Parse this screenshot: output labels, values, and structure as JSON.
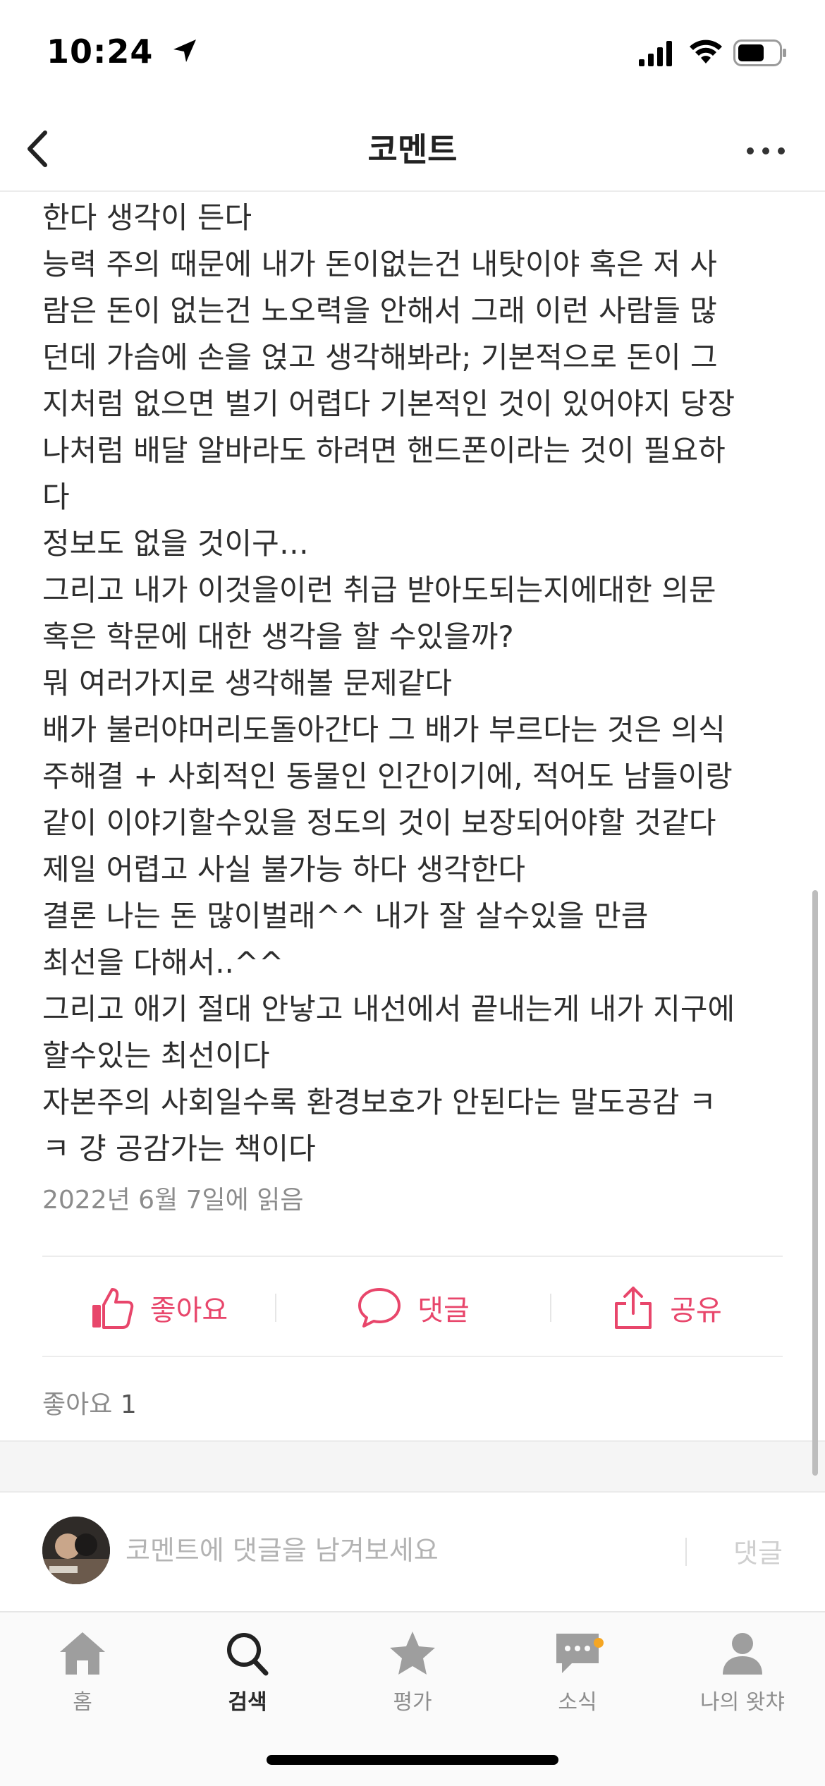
{
  "status_bar": {
    "time": "10:24"
  },
  "nav": {
    "title": "코멘트"
  },
  "comment": {
    "lines": [
      "한다 생각이 든다",
      "능력 주의 때문에 내가 돈이없는건 내탓이야 혹은 저 사",
      "람은 돈이 없는건 노오력을 안해서 그래 이런 사람들 많",
      "던데 가슴에 손을 얹고 생각해봐라; 기본적으로 돈이 그",
      "지처럼 없으면 벌기 어렵다 기본적인 것이 있어야지 당장",
      "나처럼 배달 알바라도 하려면 핸드폰이라는 것이 필요하",
      "다",
      "정보도 없을 것이구…",
      "그리고 내가 이것을이런 취급 받아도되는지에대한 의문",
      "혹은 학문에 대한 생각을 할 수있을까?",
      "뭐 여러가지로 생각해볼 문제같다",
      "배가 불러야머리도돌아간다 그 배가 부르다는 것은 의식",
      "주해결 + 사회적인 동물인 인간이기에, 적어도 남들이랑",
      "같이 이야기할수있을 정도의 것이 보장되어야할 것같다",
      "제일 어렵고 사실 불가능 하다 생각한다",
      "결론 나는 돈 많이벌래^^ 내가 잘 살수있을 만큼",
      "최선을 다해서..^^",
      "그리고 애기 절대 안낳고 내선에서 끝내는게 내가 지구에",
      "할수있는 최선이다",
      "자본주의 사회일수록 환경보호가 안된다는 말도공감 ㅋ",
      "ㅋ 걍 공감가는 책이다"
    ],
    "read_date": "2022년 6월 7일에 읽음"
  },
  "actions": {
    "like_label": "좋아요",
    "comment_label": "댓글",
    "share_label": "공유"
  },
  "likes": {
    "label": "좋아요",
    "count": "1"
  },
  "reply": {
    "placeholder": "코멘트에 댓글을 남겨보세요",
    "submit_label": "댓글"
  },
  "tabs": [
    {
      "label": "홈",
      "icon": "home-icon"
    },
    {
      "label": "검색",
      "icon": "search-icon",
      "active": true
    },
    {
      "label": "평가",
      "icon": "star-icon"
    },
    {
      "label": "소식",
      "icon": "chat-bubble-icon"
    },
    {
      "label": "나의 왓챠",
      "icon": "person-icon"
    }
  ],
  "colors": {
    "accent": "#e8466b",
    "muted_text": "#8c8c8c",
    "notification_dot": "#f5a623"
  }
}
